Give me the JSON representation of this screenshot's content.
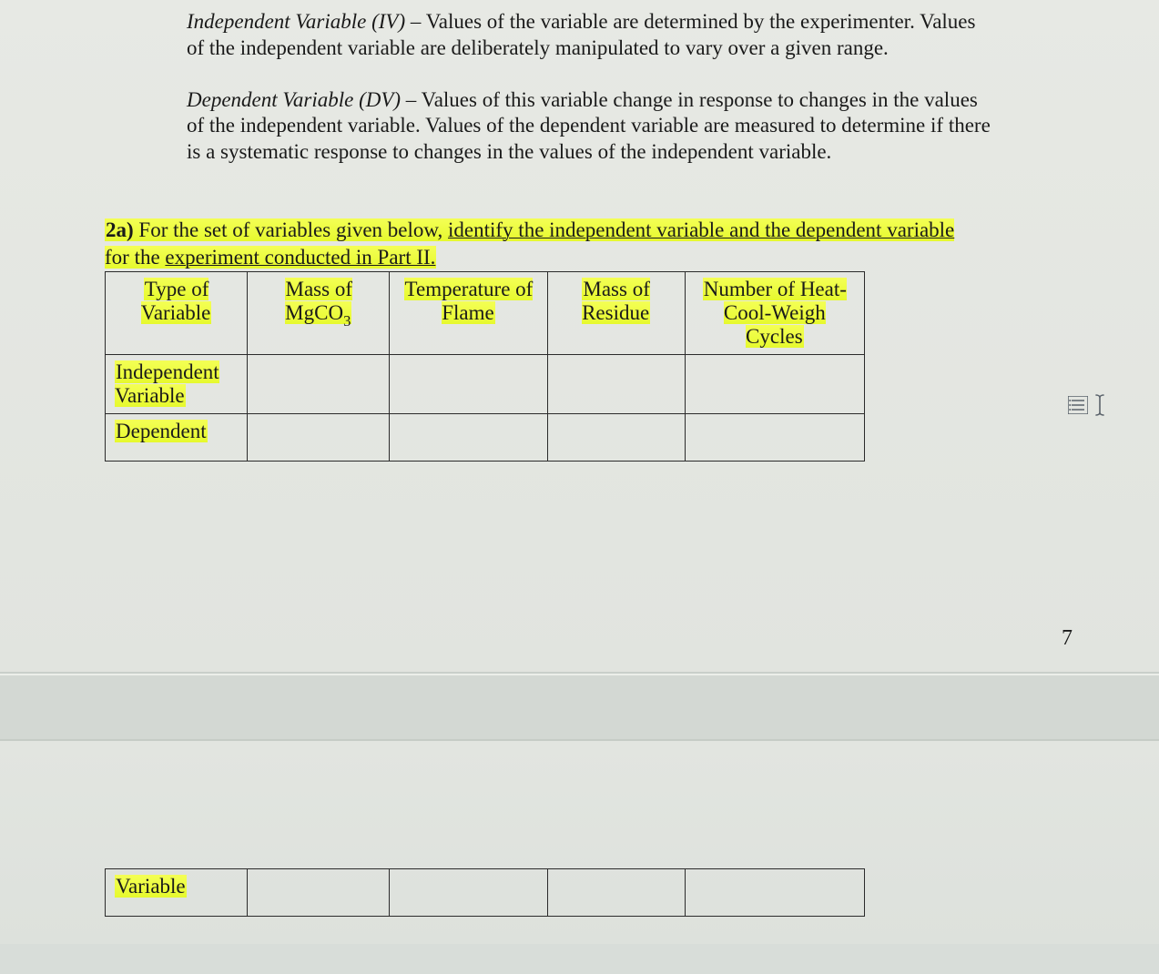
{
  "definitions": {
    "iv": {
      "term": "Independent Variable (IV)",
      "text": " – Values of the variable are determined by the experimenter. Values of the independent variable are deliberately manipulated to vary over a given range."
    },
    "dv": {
      "term": "Dependent Variable (DV)",
      "text": " – Values of this variable change in response to changes in the values of the independent variable. Values of the dependent variable are measured to determine if there is a systematic response to changes in the values of the independent variable."
    }
  },
  "question": {
    "number": "2a)",
    "lead": " For the set of variables given below, ",
    "underlined1": "identify the independent variable and the dependent variable",
    "mid": " for the ",
    "underlined2": "experiment conducted in Part II."
  },
  "table": {
    "headers": {
      "type": "Type of Variable",
      "mgco3_line1": "Mass of",
      "mgco3_line2": "MgCO",
      "mgco3_sub": "3",
      "temp": "Temperature of Flame",
      "mass_res": "Mass of Residue",
      "cycles": "Number of Heat-Cool-Weigh Cycles"
    },
    "rows": {
      "iv_label": "Independent Variable",
      "dep_label": "Dependent",
      "var_label": "Variable"
    }
  },
  "page_number": "7",
  "icons": {
    "side_list": "list-icon",
    "side_cursor": "text-cursor-icon"
  }
}
